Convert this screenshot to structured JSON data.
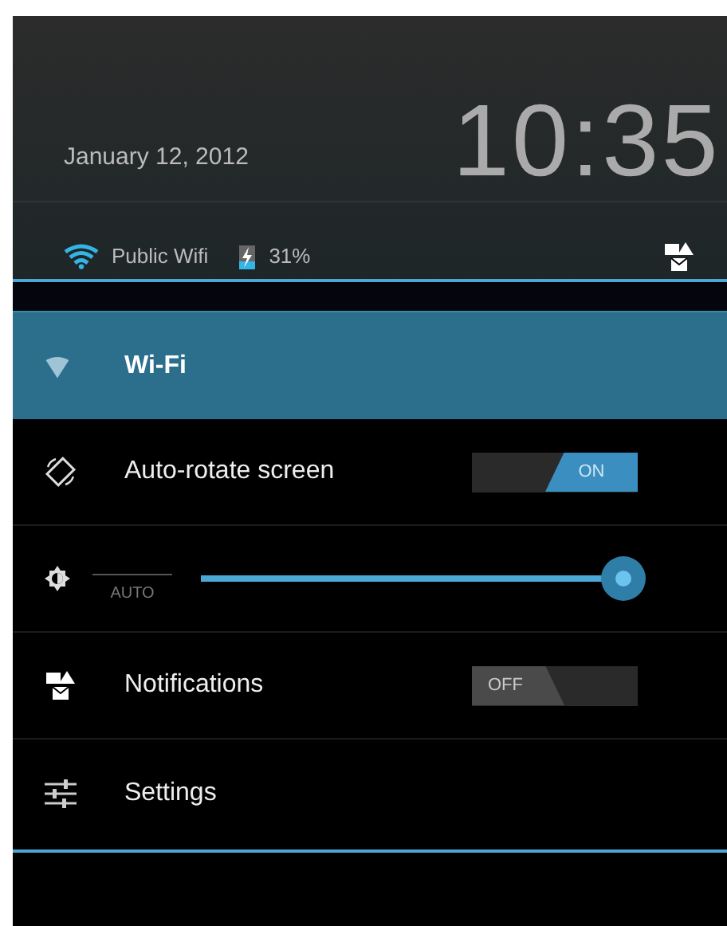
{
  "header": {
    "date": "January 12, 2012",
    "time": "10:35",
    "network": "Public Wifi",
    "battery": "31%"
  },
  "rows": [
    {
      "kind": "plain",
      "label": "Wi-Fi",
      "selected": true
    },
    {
      "kind": "switch",
      "label": "Auto-rotate screen",
      "selected": false,
      "on": true,
      "state_label": "ON"
    },
    {
      "kind": "slider",
      "selected": false,
      "level": 0.98,
      "auto_label": "AUTO"
    },
    {
      "kind": "switch",
      "label": "Notifications",
      "selected": false,
      "on": false,
      "state_label": "OFF"
    },
    {
      "kind": "plain",
      "label": "Settings",
      "selected": false
    }
  ]
}
